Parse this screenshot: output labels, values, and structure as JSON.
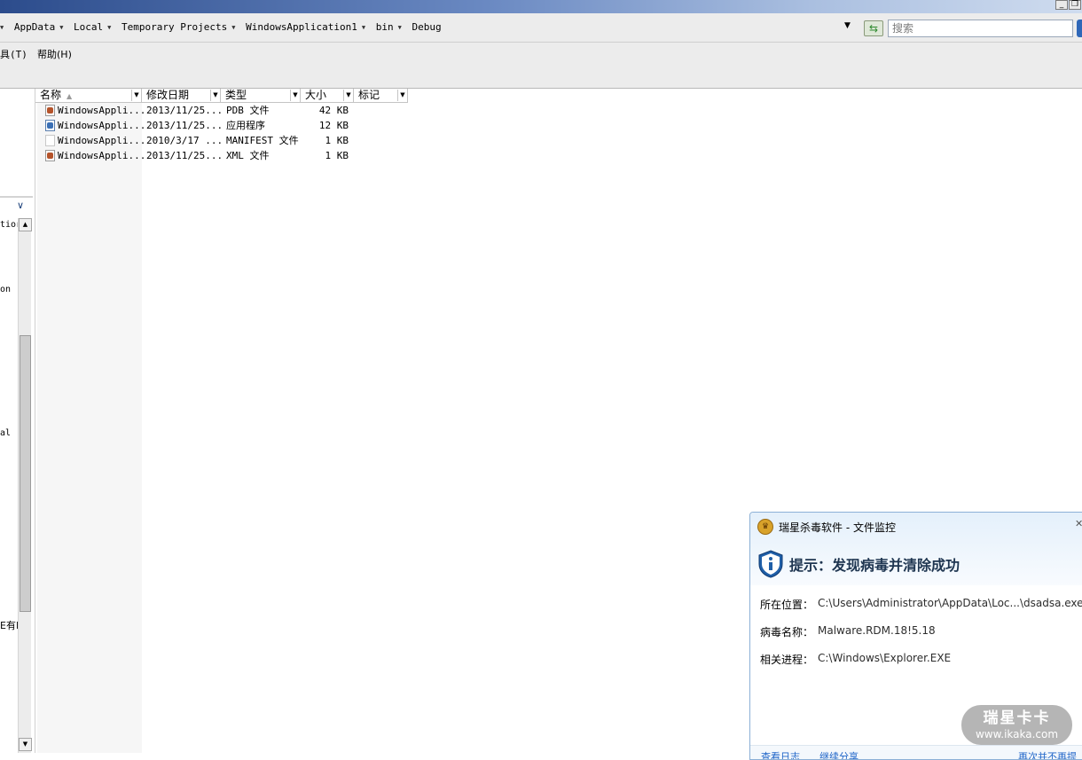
{
  "window": {
    "minimize_glyph": "_",
    "restore_glyph": "❐"
  },
  "address": {
    "crumbs": [
      "AppData",
      "Local",
      "Temporary Projects",
      "WindowsApplication1",
      "bin",
      "Debug"
    ],
    "search_placeholder": "搜索"
  },
  "menu": {
    "tools": "具(T)",
    "help": "帮助(H)"
  },
  "left_pane": {
    "fragments": [
      "tior",
      "on",
      "al",
      "E有E"
    ]
  },
  "columns": [
    "名称",
    "修改日期",
    "类型",
    "大小",
    "标记"
  ],
  "files": [
    {
      "name": "WindowsAppli...",
      "date": "2013/11/25...",
      "type": "PDB 文件",
      "size": "42 KB",
      "icon": "pdb-file-icon",
      "icon_color": "#b5532a"
    },
    {
      "name": "WindowsAppli...",
      "date": "2013/11/25...",
      "type": "应用程序",
      "size": "12 KB",
      "icon": "application-icon",
      "icon_color": "#3a6fb5"
    },
    {
      "name": "WindowsAppli...",
      "date": "2010/3/17 ...",
      "type": "MANIFEST 文件",
      "size": "1 KB",
      "icon": "blank-file-icon",
      "icon_color": "#ffffff"
    },
    {
      "name": "WindowsAppli...",
      "date": "2013/11/25...",
      "type": "XML 文件",
      "size": "1 KB",
      "icon": "xml-file-icon",
      "icon_color": "#b5532a"
    }
  ],
  "popup": {
    "title": "瑞星杀毒软件 - 文件监控",
    "message": "提示：发现病毒并清除成功",
    "location_label": "所在位置：",
    "location_value": "C:\\Users\\Administrator\\AppData\\Loc...\\dsadsa.exe",
    "virus_label": "病毒名称：",
    "virus_value": "Malware.RDM.18!5.18",
    "process_label": "相关进程：",
    "process_value": "C:\\Windows\\Explorer.EXE",
    "footer_links": [
      "查看日志",
      "继续分享",
      "再次并不再提"
    ],
    "accent_color": "#1e64c8"
  },
  "watermark": {
    "main": "瑞星卡卡",
    "sub": "www.ikaka.com"
  }
}
